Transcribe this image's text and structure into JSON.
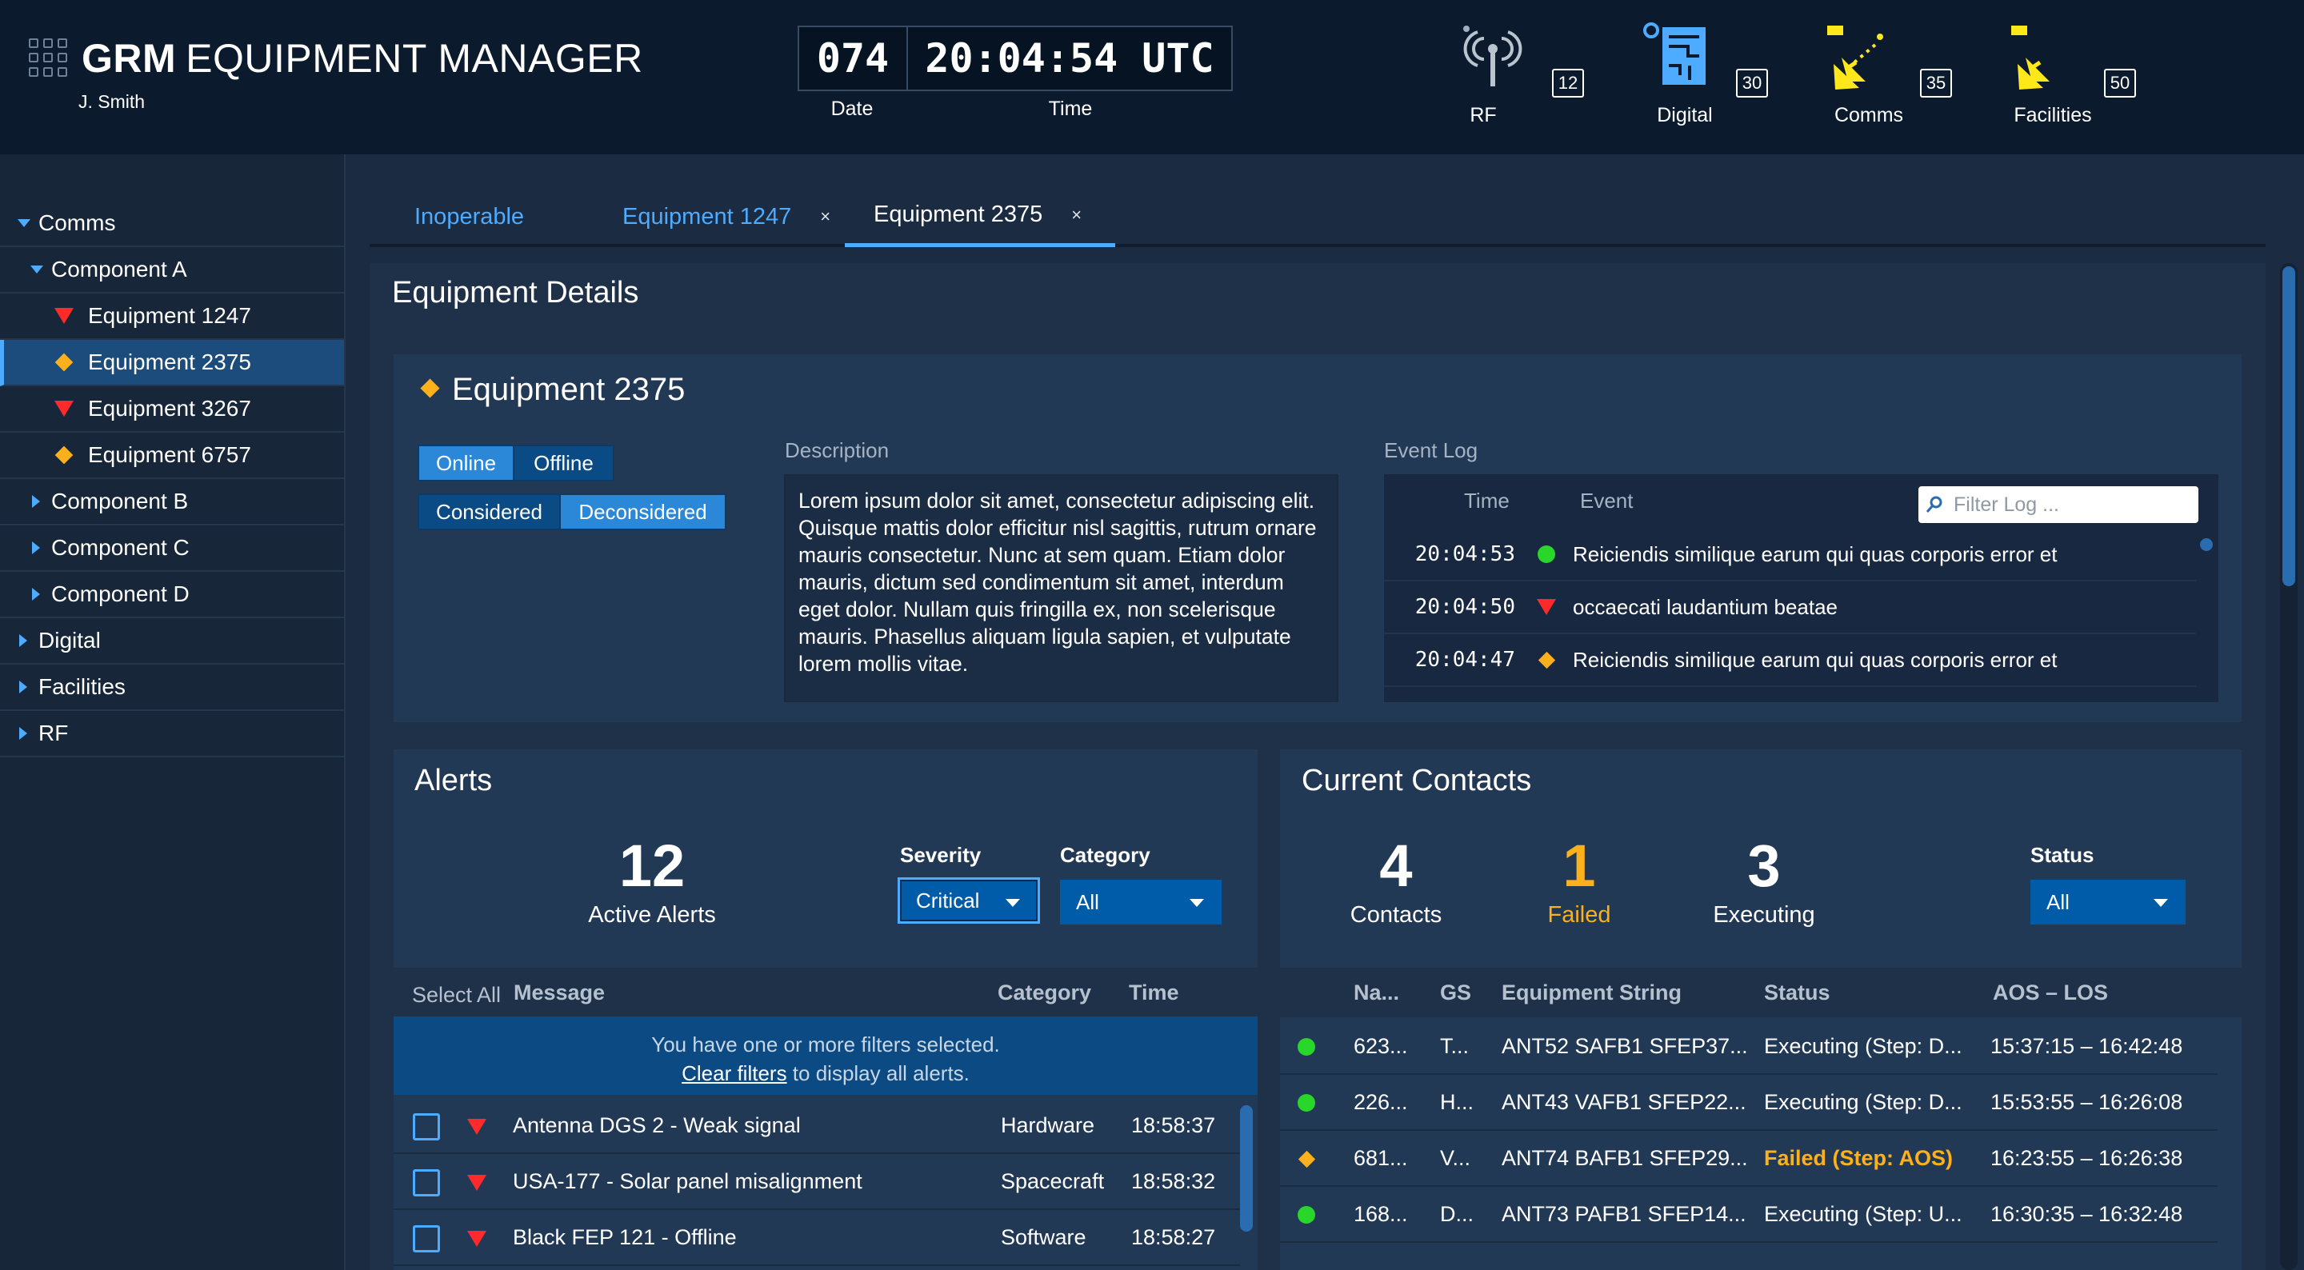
{
  "header": {
    "brand": "GRM",
    "app_name": "EQUIPMENT MANAGER",
    "user": "J. Smith",
    "date_value": "074",
    "time_value": "20:04:54 UTC",
    "date_label": "Date",
    "time_label": "Time",
    "monitors": [
      {
        "label": "RF",
        "count": "12",
        "icon": "antenna-icon"
      },
      {
        "label": "Digital",
        "count": "30",
        "icon": "processor-icon"
      },
      {
        "label": "Comms",
        "count": "35",
        "icon": "satellite-dish-icon"
      },
      {
        "label": "Facilities",
        "count": "50",
        "icon": "satellite-dish-icon"
      }
    ]
  },
  "sidebar": {
    "items": [
      {
        "label": "Comms"
      },
      {
        "label": "Component A"
      },
      {
        "label": "Equipment 1247"
      },
      {
        "label": "Equipment 2375"
      },
      {
        "label": "Equipment 3267"
      },
      {
        "label": "Equipment 6757"
      },
      {
        "label": "Component B"
      },
      {
        "label": "Component C"
      },
      {
        "label": "Component D"
      },
      {
        "label": "Digital"
      },
      {
        "label": "Facilities"
      },
      {
        "label": "RF"
      }
    ]
  },
  "tabs": [
    {
      "label": "Inoperable"
    },
    {
      "label": "Equipment 1247",
      "close": "×"
    },
    {
      "label": "Equipment 2375",
      "close": "×"
    }
  ],
  "details": {
    "panel_title": "Equipment Details",
    "equipment_name": "Equipment 2375",
    "online_label": "Online",
    "offline_label": "Offline",
    "considered_label": "Considered",
    "deconsidered_label": "Deconsidered",
    "description_label": "Description",
    "description_text": "Lorem ipsum dolor sit amet, consectetur adipiscing elit. Quisque mattis dolor efficitur nisl sagittis, rutrum ornare mauris consectetur. Nunc at sem quam. Etiam dolor mauris, dictum sed condimentum sit amet, interdum eget dolor. Nullam quis fringilla ex, non scelerisque mauris. Phasellus aliquam ligula sapien, et vulputate lorem mollis vitae.",
    "event_log_label": "Event Log",
    "log_time_header": "Time",
    "log_event_header": "Event",
    "filter_placeholder": "Filter Log ...",
    "log_rows": [
      {
        "time": "20:04:53",
        "status": "normal",
        "event": "Reiciendis similique earum qui quas corporis error et"
      },
      {
        "time": "20:04:50",
        "status": "critical",
        "event": "occaecati laudantium beatae"
      },
      {
        "time": "20:04:47",
        "status": "caution",
        "event": "Reiciendis similique earum qui quas corporis error et"
      }
    ]
  },
  "alerts": {
    "title": "Alerts",
    "count": "12",
    "count_label": "Active Alerts",
    "severity_label": "Severity",
    "severity_value": "Critical",
    "category_label": "Category",
    "category_value": "All",
    "select_all": "Select All",
    "col_message": "Message",
    "col_category": "Category",
    "col_time": "Time",
    "notice_line1": "You have one or more filters selected.",
    "notice_link": "Clear filters",
    "notice_line2": " to display all alerts.",
    "rows": [
      {
        "message": "Antenna DGS 2 - Weak signal",
        "category": "Hardware",
        "time": "18:58:37"
      },
      {
        "message": "USA-177 - Solar panel misalignment",
        "category": "Spacecraft",
        "time": "18:58:32"
      },
      {
        "message": "Black FEP 121 - Offline",
        "category": "Software",
        "time": "18:58:27"
      }
    ]
  },
  "contacts": {
    "title": "Current Contacts",
    "contacts_count": "4",
    "contacts_label": "Contacts",
    "failed_count": "1",
    "failed_label": "Failed",
    "executing_count": "3",
    "executing_label": "Executing",
    "status_label": "Status",
    "status_value": "All",
    "col_name": "Na...",
    "col_gs": "GS",
    "col_equipment": "Equipment String",
    "col_status": "Status",
    "col_aos": "AOS – LOS",
    "rows": [
      {
        "state": "normal",
        "name": "623...",
        "gs": "T...",
        "equipment": "ANT52 SAFB1 SFEP37...",
        "status": "Executing (Step: D...",
        "aos": "15:37:15 – 16:42:48"
      },
      {
        "state": "normal",
        "name": "226...",
        "gs": "H...",
        "equipment": "ANT43 VAFB1 SFEP22...",
        "status": "Executing (Step: D...",
        "aos": "15:53:55 – 16:26:08"
      },
      {
        "state": "caution",
        "name": "681...",
        "gs": "V...",
        "equipment": "ANT74 BAFB1 SFEP29...",
        "status": "Failed (Step: AOS)",
        "aos": "16:23:55 – 16:26:38"
      },
      {
        "state": "normal",
        "name": "168...",
        "gs": "D...",
        "equipment": "ANT73 PAFB1 SFEP14...",
        "status": "Executing (Step: U...",
        "aos": "16:30:35 – 16:32:48"
      }
    ]
  },
  "colors": {
    "accent": "#4dacff",
    "critical": "#ff2a2a",
    "caution": "#fcb01c",
    "normal": "#29d62a",
    "header_bg": "#0b1a2c"
  }
}
